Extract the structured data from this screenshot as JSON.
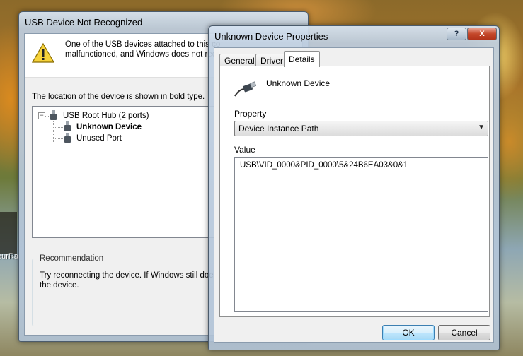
{
  "desktop": {
    "icon_label": "eurRa"
  },
  "usb_window": {
    "title": "USB Device Not Recognized",
    "intro_line1": "One of the USB devices attached to this co",
    "intro_line2": "malfunctioned, and Windows does not reco",
    "location_text": "The location of the device is shown in bold type.",
    "tree": {
      "root": "USB Root Hub (2 ports)",
      "expander": "−",
      "children": [
        "Unknown Device",
        "Unused Port"
      ]
    },
    "recommendation": {
      "title": "Recommendation",
      "line1": "Try reconnecting the device. If Windows still does",
      "line2": "the device."
    }
  },
  "props_window": {
    "title": "Unknown Device Properties",
    "help_label": "?",
    "close_label": "X",
    "tabs": [
      {
        "label": "General",
        "active": false
      },
      {
        "label": "Driver",
        "active": false
      },
      {
        "label": "Details",
        "active": true
      }
    ],
    "device_name": "Unknown Device",
    "property_label": "Property",
    "property_selected": "Device Instance Path",
    "value_label": "Value",
    "values": [
      "USB\\VID_0000&PID_0000\\5&24B6EA03&0&1"
    ],
    "ok_label": "OK",
    "cancel_label": "Cancel"
  }
}
